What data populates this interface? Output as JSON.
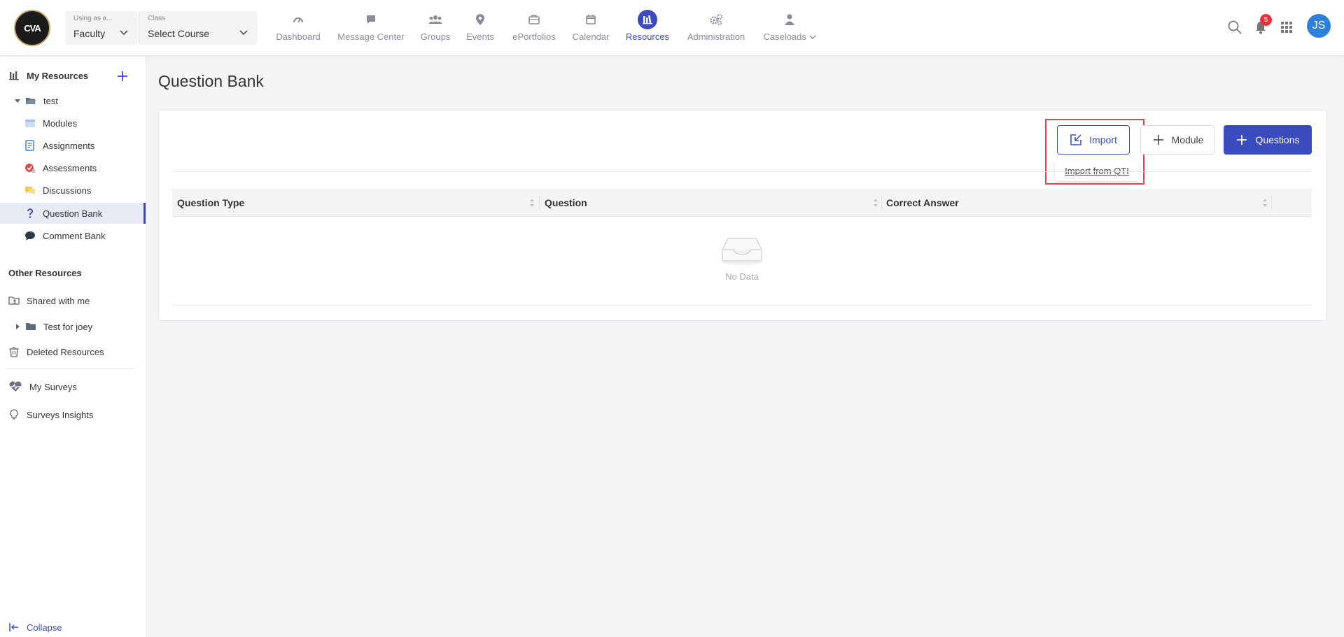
{
  "header": {
    "logo_text": "CVA",
    "role_selector": {
      "caption": "Using as a...",
      "value": "Faculty"
    },
    "class_selector": {
      "caption": "Class",
      "value": "Select Course"
    },
    "nav": [
      {
        "label": "Dashboard",
        "icon": "gauge-icon"
      },
      {
        "label": "Message Center",
        "icon": "chat-icon"
      },
      {
        "label": "Groups",
        "icon": "users-icon"
      },
      {
        "label": "Events",
        "icon": "location-pin-icon"
      },
      {
        "label": "ePortfolios",
        "icon": "briefcase-icon"
      },
      {
        "label": "Calendar",
        "icon": "calendar-icon"
      },
      {
        "label": "Resources",
        "icon": "library-icon",
        "active": true
      },
      {
        "label": "Administration",
        "icon": "gears-icon"
      },
      {
        "label": "Caseloads",
        "icon": "person-icon"
      }
    ],
    "notification_count": "5",
    "avatar_initials": "JS"
  },
  "sidebar": {
    "my_resources_label": "My Resources",
    "folder_name": "test",
    "items": [
      {
        "label": "Modules",
        "icon": "modules-icon"
      },
      {
        "label": "Assignments",
        "icon": "assignment-icon"
      },
      {
        "label": "Assessments",
        "icon": "assessment-icon"
      },
      {
        "label": "Discussions",
        "icon": "discussion-icon"
      },
      {
        "label": "Question Bank",
        "icon": "question-icon",
        "active": true
      },
      {
        "label": "Comment Bank",
        "icon": "comment-icon"
      }
    ],
    "other_resources_label": "Other Resources",
    "shared_label": "Shared with me",
    "shared_folder": "Test for joey",
    "deleted_label": "Deleted Resources",
    "my_surveys_label": "My Surveys",
    "survey_insights_label": "Surveys Insights",
    "collapse_label": "Collapse"
  },
  "main": {
    "page_title": "Question Bank",
    "import_label": "Import",
    "import_from_qti_label": "Import from QTI",
    "module_label": "Module",
    "questions_label": "Questions",
    "columns": [
      "Question Type",
      "Question",
      "Correct Answer"
    ],
    "empty_text": "No Data"
  },
  "colors": {
    "accent": "#3a4bbf",
    "highlight": "#e0484b",
    "badge": "#e8323b",
    "avatar": "#2f80d9"
  }
}
